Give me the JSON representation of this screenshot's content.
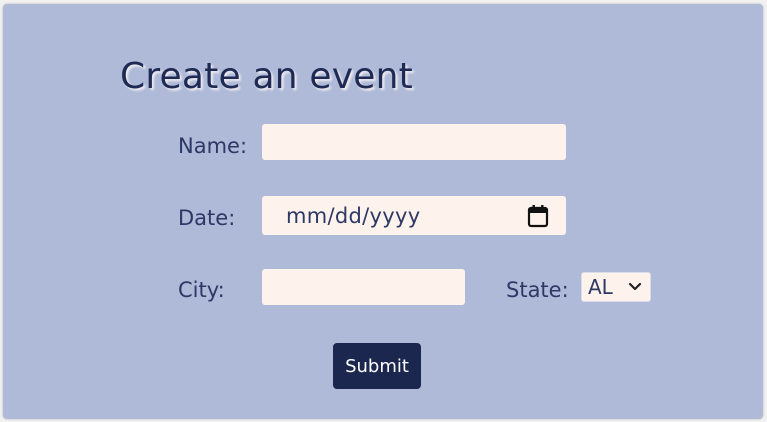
{
  "form": {
    "title": "Create an event",
    "name": {
      "label": "Name:",
      "value": "",
      "placeholder": ""
    },
    "date": {
      "label": "Date:",
      "value": "mm/dd/yyyy",
      "icon": "calendar-icon"
    },
    "city": {
      "label": "City:",
      "value": "",
      "placeholder": ""
    },
    "state": {
      "label": "State:",
      "selected": "AL",
      "icon": "chevron-down-icon"
    },
    "submit_label": "Submit"
  },
  "colors": {
    "background": "#aebad8",
    "input_fill": "#fdf3ec",
    "title_text": "#1e2a54",
    "label_text": "#2d3866",
    "button_fill": "#1c2750",
    "button_text": "#ffffff"
  }
}
